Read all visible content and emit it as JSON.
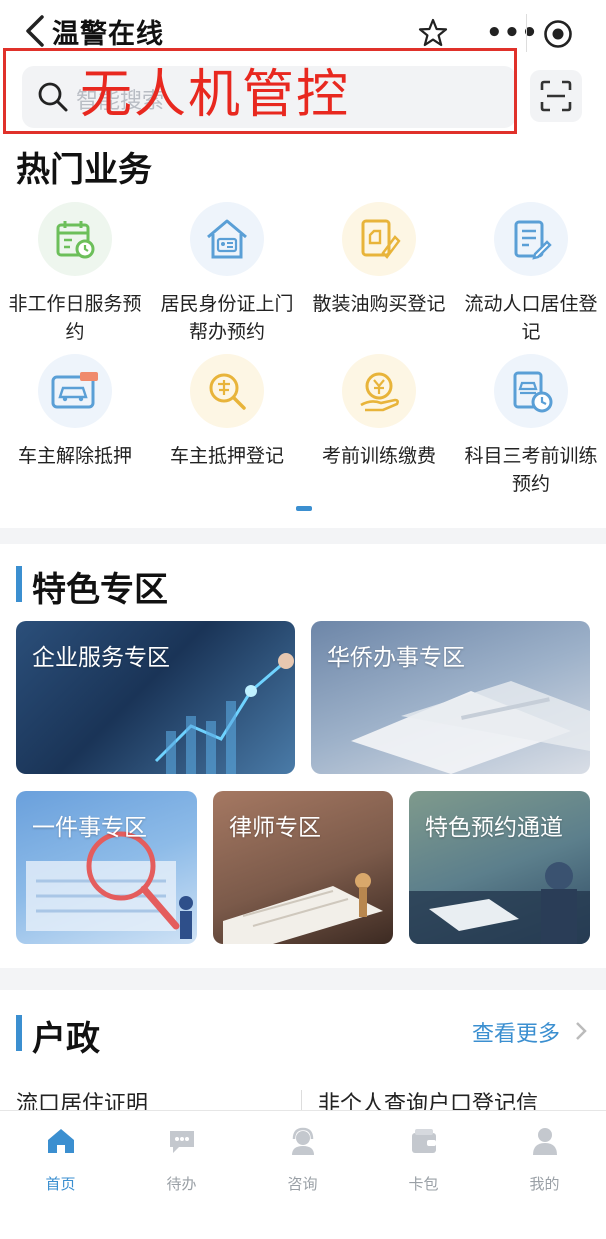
{
  "header": {
    "title": "温警在线",
    "more": "•••"
  },
  "search": {
    "placeholder": "智能搜索",
    "overlay_label": "无人机管控"
  },
  "hot": {
    "title": "热门业务",
    "items": [
      {
        "label": "非工作日服务预约",
        "icon": "calendar-clock-icon"
      },
      {
        "label": "居民身份证上门帮办预约",
        "icon": "house-id-icon"
      },
      {
        "label": "散装油购买登记",
        "icon": "oil-can-icon"
      },
      {
        "label": "流动人口居住登记",
        "icon": "document-edit-icon"
      },
      {
        "label": "车主解除抵押",
        "icon": "car-tag-icon"
      },
      {
        "label": "车主抵押登记",
        "icon": "mortgage-search-icon"
      },
      {
        "label": "考前训练缴费",
        "icon": "payment-hand-icon"
      },
      {
        "label": "科目三考前训练预约",
        "icon": "car-schedule-icon"
      }
    ]
  },
  "feature": {
    "title": "特色专区",
    "cards": [
      {
        "label": "企业服务专区"
      },
      {
        "label": "华侨办事专区"
      },
      {
        "label": "一件事专区"
      },
      {
        "label": "律师专区"
      },
      {
        "label": "特色预约通道"
      }
    ]
  },
  "household": {
    "title": "户政",
    "more": "查看更多",
    "items": [
      "流口居住证明",
      "非个人查询户口登记信"
    ]
  },
  "nav": {
    "items": [
      {
        "label": "首页",
        "icon": "home-icon",
        "active": true
      },
      {
        "label": "待办",
        "icon": "chat-bubble-icon",
        "active": false
      },
      {
        "label": "咨询",
        "icon": "headset-icon",
        "active": false
      },
      {
        "label": "卡包",
        "icon": "wallet-icon",
        "active": false
      },
      {
        "label": "我的",
        "icon": "user-icon",
        "active": false
      }
    ]
  },
  "colors": {
    "accent": "#3b8fd0",
    "overlay_red": "#e8281f"
  }
}
